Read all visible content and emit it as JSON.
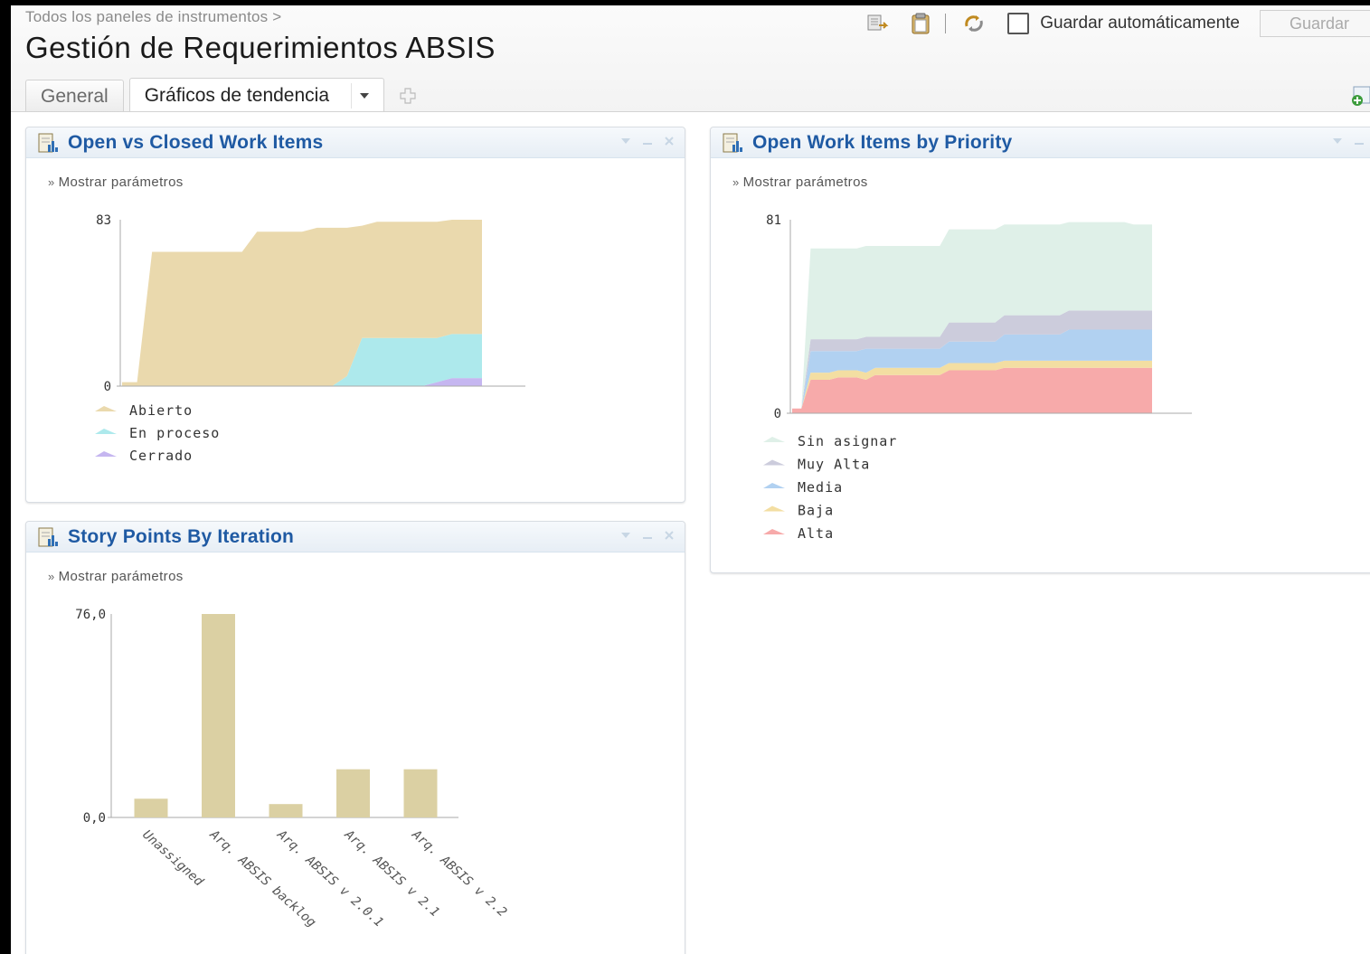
{
  "breadcrumb": "Todos los paneles de instrumentos >",
  "page_title": "Gestión de Requerimientos ABSIS",
  "toolbar": {
    "autosave_label": "Guardar automáticamente",
    "autosave_checked": false,
    "save_label": "Guardar"
  },
  "tabs": [
    {
      "label": "General",
      "active": false
    },
    {
      "label": "Gráficos de tendencia",
      "active": true
    }
  ],
  "widgets": {
    "open_vs_closed": {
      "title": "Open vs Closed Work Items",
      "params_label": "Mostrar parámetros"
    },
    "by_priority": {
      "title": "Open Work Items by Priority",
      "params_label": "Mostrar parámetros"
    },
    "story_points": {
      "title": "Story Points By Iteration",
      "params_label": "Mostrar parámetros"
    }
  },
  "colors": {
    "title_blue": "#1f5aa3",
    "abierto": "#ead9ad",
    "en_proceso": "#ade9ec",
    "cerrado": "#c5b6f0",
    "sin_asignar": "#dff0e8",
    "muy_alta": "#ccccdc",
    "media": "#b1d1f1",
    "baja": "#f3dea2",
    "alta": "#f7aaaa",
    "bar": "#dbd0a3"
  },
  "chart_data": [
    {
      "id": "open_vs_closed",
      "type": "area",
      "stacked": true,
      "ylim": [
        0,
        83
      ],
      "yticks": [
        "0",
        "83"
      ],
      "x": [
        0,
        1,
        2,
        3,
        4,
        5,
        6,
        7,
        8,
        9,
        10,
        11,
        12,
        13,
        14,
        15,
        16,
        17,
        18,
        19,
        20,
        21,
        22,
        23,
        24
      ],
      "series": [
        {
          "name": "Cerrado",
          "color": "#c5b6f0",
          "values": [
            0,
            0,
            0,
            0,
            0,
            0,
            0,
            0,
            0,
            0,
            0,
            0,
            0,
            0,
            0,
            0,
            0,
            0,
            0,
            0,
            0,
            2,
            4,
            4,
            4
          ]
        },
        {
          "name": "En proceso",
          "color": "#ade9ec",
          "values": [
            0,
            0,
            0,
            0,
            0,
            0,
            0,
            0,
            0,
            0,
            0,
            0,
            0,
            0,
            0,
            5,
            24,
            24,
            24,
            24,
            24,
            22,
            22,
            22,
            22
          ]
        },
        {
          "name": "Abierto",
          "color": "#ead9ad",
          "values": [
            2,
            2,
            67,
            67,
            67,
            67,
            67,
            67,
            67,
            77,
            77,
            77,
            77,
            79,
            79,
            74,
            56,
            58,
            58,
            58,
            58,
            58,
            57,
            57,
            57
          ]
        }
      ],
      "legend": [
        "Abierto",
        "En proceso",
        "Cerrado"
      ]
    },
    {
      "id": "by_priority",
      "type": "area",
      "stacked": true,
      "ylim": [
        0,
        81
      ],
      "yticks": [
        "0",
        "81"
      ],
      "x": [
        0,
        1,
        2,
        3,
        4,
        5,
        6,
        7,
        8,
        9,
        10,
        11,
        12,
        13,
        14,
        15,
        16,
        17,
        18,
        19,
        20,
        21,
        22,
        23,
        24,
        25,
        26,
        27,
        28,
        29,
        30,
        31,
        32,
        33,
        34,
        35,
        36,
        37,
        38,
        39
      ],
      "series": [
        {
          "name": "Alta",
          "color": "#f7aaaa",
          "values": [
            2,
            2,
            14,
            14,
            14,
            15,
            15,
            15,
            14,
            16,
            16,
            16,
            16,
            16,
            16,
            16,
            16,
            18,
            18,
            18,
            18,
            18,
            18,
            19,
            19,
            19,
            19,
            19,
            19,
            19,
            19,
            19,
            19,
            19,
            19,
            19,
            19,
            19,
            19,
            19
          ]
        },
        {
          "name": "Baja",
          "color": "#f3dea2",
          "values": [
            0,
            0,
            3,
            3,
            3,
            3,
            3,
            3,
            3,
            3,
            3,
            3,
            3,
            3,
            3,
            3,
            3,
            3,
            3,
            3,
            3,
            3,
            3,
            3,
            3,
            3,
            3,
            3,
            3,
            3,
            3,
            3,
            3,
            3,
            3,
            3,
            3,
            3,
            3,
            3
          ]
        },
        {
          "name": "Media",
          "color": "#b1d1f1",
          "values": [
            0,
            0,
            9,
            9,
            9,
            8,
            8,
            8,
            10,
            8,
            8,
            8,
            8,
            8,
            8,
            8,
            8,
            9,
            9,
            9,
            9,
            9,
            9,
            11,
            11,
            11,
            11,
            11,
            11,
            11,
            13,
            13,
            13,
            13,
            13,
            13,
            13,
            13,
            13,
            13
          ]
        },
        {
          "name": "Muy Alta",
          "color": "#ccccdc",
          "values": [
            0,
            0,
            5,
            5,
            5,
            5,
            5,
            5,
            5,
            5,
            5,
            5,
            5,
            5,
            5,
            5,
            5,
            8,
            8,
            8,
            8,
            8,
            8,
            8,
            8,
            8,
            8,
            8,
            8,
            8,
            8,
            8,
            8,
            8,
            8,
            8,
            8,
            8,
            8,
            8
          ]
        },
        {
          "name": "Sin asignar",
          "color": "#dff0e8",
          "values": [
            0,
            0,
            38,
            38,
            38,
            38,
            38,
            38,
            38,
            38,
            38,
            38,
            38,
            38,
            38,
            38,
            38,
            39,
            39,
            39,
            39,
            39,
            39,
            38,
            38,
            38,
            38,
            38,
            38,
            38,
            37,
            37,
            37,
            37,
            37,
            37,
            37,
            36,
            36,
            36
          ]
        }
      ],
      "legend": [
        "Sin asignar",
        "Muy Alta",
        "Media",
        "Baja",
        "Alta"
      ]
    },
    {
      "id": "story_points",
      "type": "bar",
      "ylim": [
        0,
        76
      ],
      "yticks": [
        "0,0",
        "76,0"
      ],
      "categories": [
        "Unassigned",
        "Arq. ABSIS backlog",
        "Arq. ABSIS v 2.0.1",
        "Arq. ABSIS v 2.1",
        "Arq. ABSIS v 2.2"
      ],
      "values": [
        7,
        76,
        5,
        18,
        18
      ],
      "color": "#dbd0a3"
    }
  ]
}
